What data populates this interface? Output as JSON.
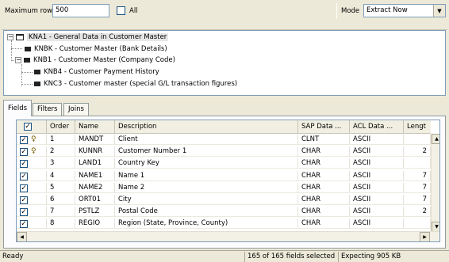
{
  "toolbar": {
    "max_rows_label": "Maximum rows",
    "max_rows_value": "500",
    "all_label": "All",
    "mode_label": "Mode",
    "mode_value": "Extract Now"
  },
  "tree": {
    "root": "KNA1 - General Data in Customer Master",
    "child_knbk": "KNBK - Customer Master (Bank Details)",
    "child_knb1": "KNB1 - Customer Master (Company Code)",
    "child_knb4": "KNB4 - Customer Payment History",
    "child_knc3": "KNC3 - Customer master (special G/L transaction figures)"
  },
  "tabs": [
    "Fields",
    "Filters",
    "Joins"
  ],
  "grid": {
    "headers": [
      "Order",
      "Name",
      "Description",
      "SAP Data ...",
      "ACL Data ...",
      "Lengt"
    ],
    "rows": [
      {
        "order": "1",
        "name": "MANDT",
        "desc": "Client",
        "sap": "CLNT",
        "acl": "ASCII",
        "len": "",
        "key": true
      },
      {
        "order": "2",
        "name": "KUNNR",
        "desc": "Customer Number 1",
        "sap": "CHAR",
        "acl": "ASCII",
        "len": "2",
        "key": true
      },
      {
        "order": "3",
        "name": "LAND1",
        "desc": "Country Key",
        "sap": "CHAR",
        "acl": "ASCII",
        "len": "",
        "key": false
      },
      {
        "order": "4",
        "name": "NAME1",
        "desc": "Name 1",
        "sap": "CHAR",
        "acl": "ASCII",
        "len": "7",
        "key": false
      },
      {
        "order": "5",
        "name": "NAME2",
        "desc": "Name 2",
        "sap": "CHAR",
        "acl": "ASCII",
        "len": "7",
        "key": false
      },
      {
        "order": "6",
        "name": "ORT01",
        "desc": "City",
        "sap": "CHAR",
        "acl": "ASCII",
        "len": "7",
        "key": false
      },
      {
        "order": "7",
        "name": "PSTLZ",
        "desc": "Postal Code",
        "sap": "CHAR",
        "acl": "ASCII",
        "len": "2",
        "key": false
      },
      {
        "order": "8",
        "name": "REGIO",
        "desc": "Region (State, Province, County)",
        "sap": "CHAR",
        "acl": "ASCII",
        "len": "",
        "key": false
      }
    ]
  },
  "status": {
    "left": "Ready",
    "selected": "165 of 165 fields selected",
    "expecting": "Expecting 905 KB"
  }
}
